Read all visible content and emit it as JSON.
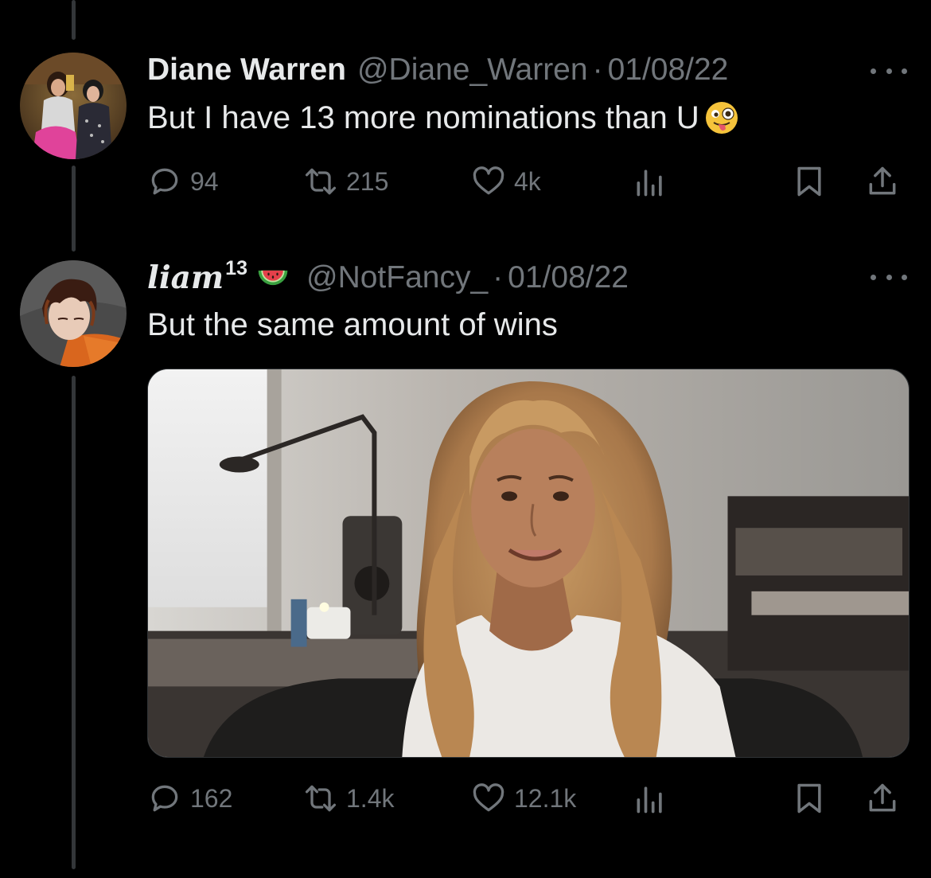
{
  "tweets": [
    {
      "name": "Diane Warren",
      "name_superscript": "",
      "handle": "@Diane_Warren",
      "separator": "·",
      "date": "01/08/22",
      "text": "But I have 13 more nominations than U",
      "emoji": "winking-face-with-tongue",
      "replies": "94",
      "retweets": "215",
      "likes": "4k"
    },
    {
      "name": "liam",
      "name_superscript": "13",
      "name_emoji": "watermelon",
      "handle": "@NotFancy_",
      "separator": "·",
      "date": "01/08/22",
      "text": "But the same amount of wins",
      "replies": "162",
      "retweets": "1.4k",
      "likes": "12.1k",
      "media": "gif-woman-smiling"
    }
  ],
  "icons": {
    "reply": "reply-icon",
    "retweet": "retweet-icon",
    "like": "heart-icon",
    "views": "analytics-icon",
    "bookmark": "bookmark-icon",
    "share": "share-icon",
    "more": "more-icon"
  },
  "colors": {
    "background": "#000000",
    "text": "#e7e9ea",
    "secondary": "#71767b",
    "thread_line": "#333639"
  }
}
